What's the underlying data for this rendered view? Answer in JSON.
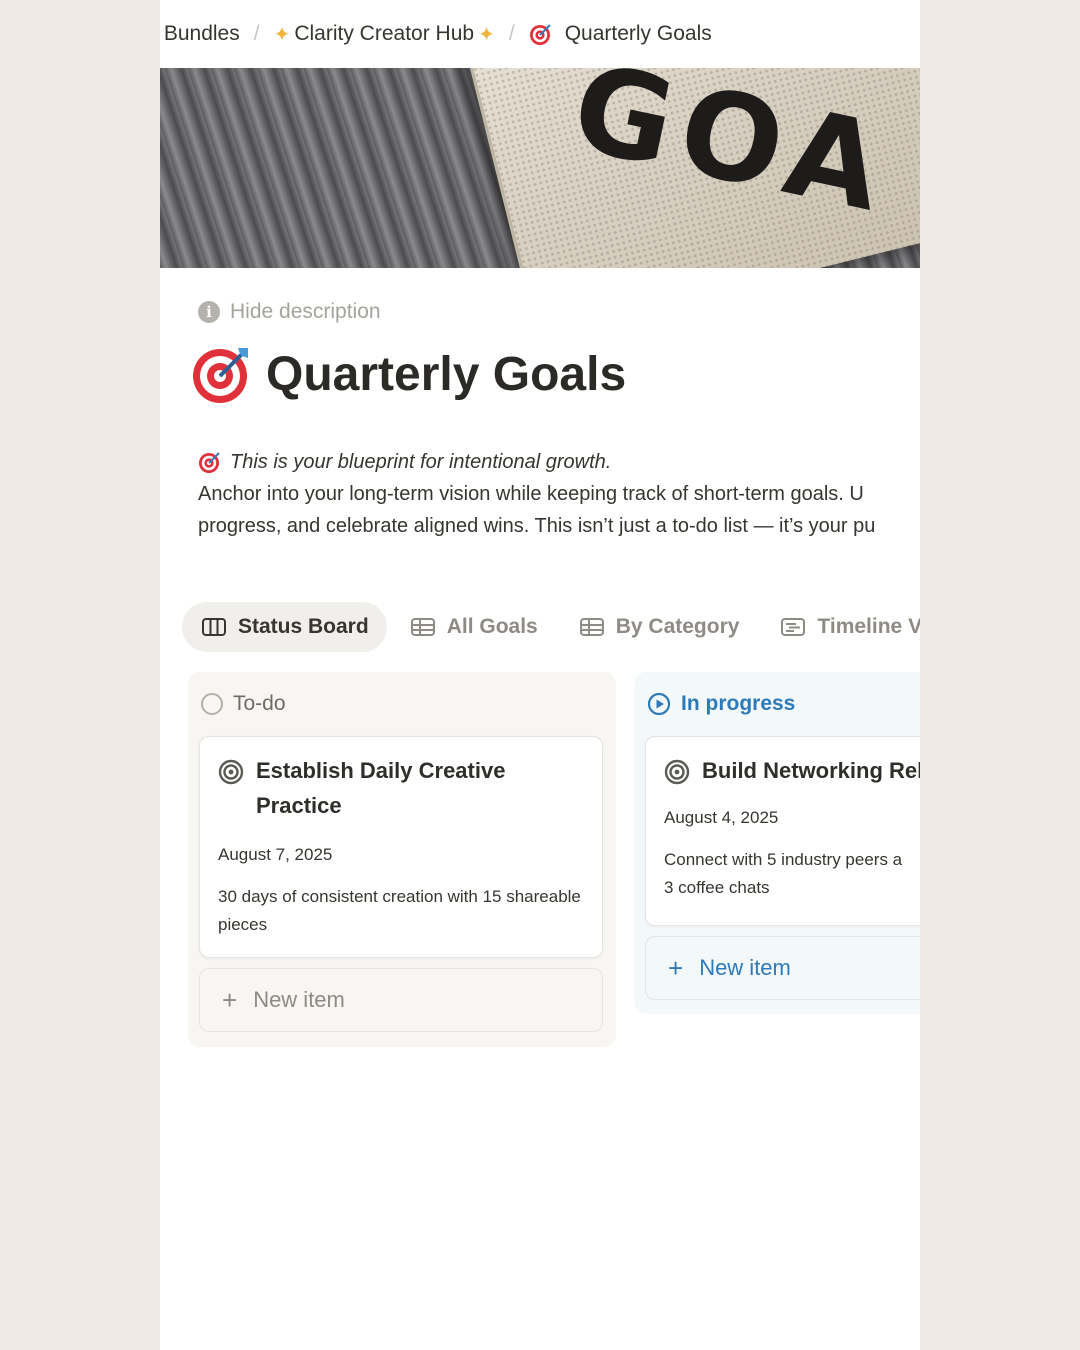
{
  "breadcrumb": {
    "items": [
      {
        "label": "Bundles"
      },
      {
        "label": "Clarity Creator Hub"
      },
      {
        "label": "Quarterly Goals"
      }
    ],
    "separator": "/",
    "sparkle": "✨"
  },
  "cover": {
    "text": "GOA"
  },
  "hide_description": {
    "label": "Hide description"
  },
  "title": "Quarterly Goals",
  "description": {
    "tagline": "This is your blueprint for intentional growth.",
    "line1": "Anchor into your long-term vision while keeping track of short-term goals. U",
    "line2": "progress, and celebrate aligned wins. This isn’t just a to-do list — it’s your pu"
  },
  "tabs": [
    {
      "label": "Status Board",
      "icon": "board-icon"
    },
    {
      "label": "All Goals",
      "icon": "table-icon"
    },
    {
      "label": "By Category",
      "icon": "table-icon"
    },
    {
      "label": "Timeline Vie",
      "icon": "timeline-icon"
    }
  ],
  "columns": {
    "todo": {
      "label": "To-do",
      "card": {
        "title": "Establish Daily Creative Practice",
        "date": "August 7, 2025",
        "desc": "30 days of consistent creation with 15 shareable pieces"
      },
      "new_item": "New item"
    },
    "in_progress": {
      "label": "In progress",
      "card": {
        "title": "Build Networking Rel",
        "date": "August 4, 2025",
        "desc_line1": "Connect with 5 industry peers a",
        "desc_line2": "3 coffee chats"
      },
      "new_item": "New item"
    }
  },
  "colors": {
    "page_bg": "#efebe4",
    "accent_blue": "#2e7ab8",
    "target_red": "#e0303a"
  }
}
